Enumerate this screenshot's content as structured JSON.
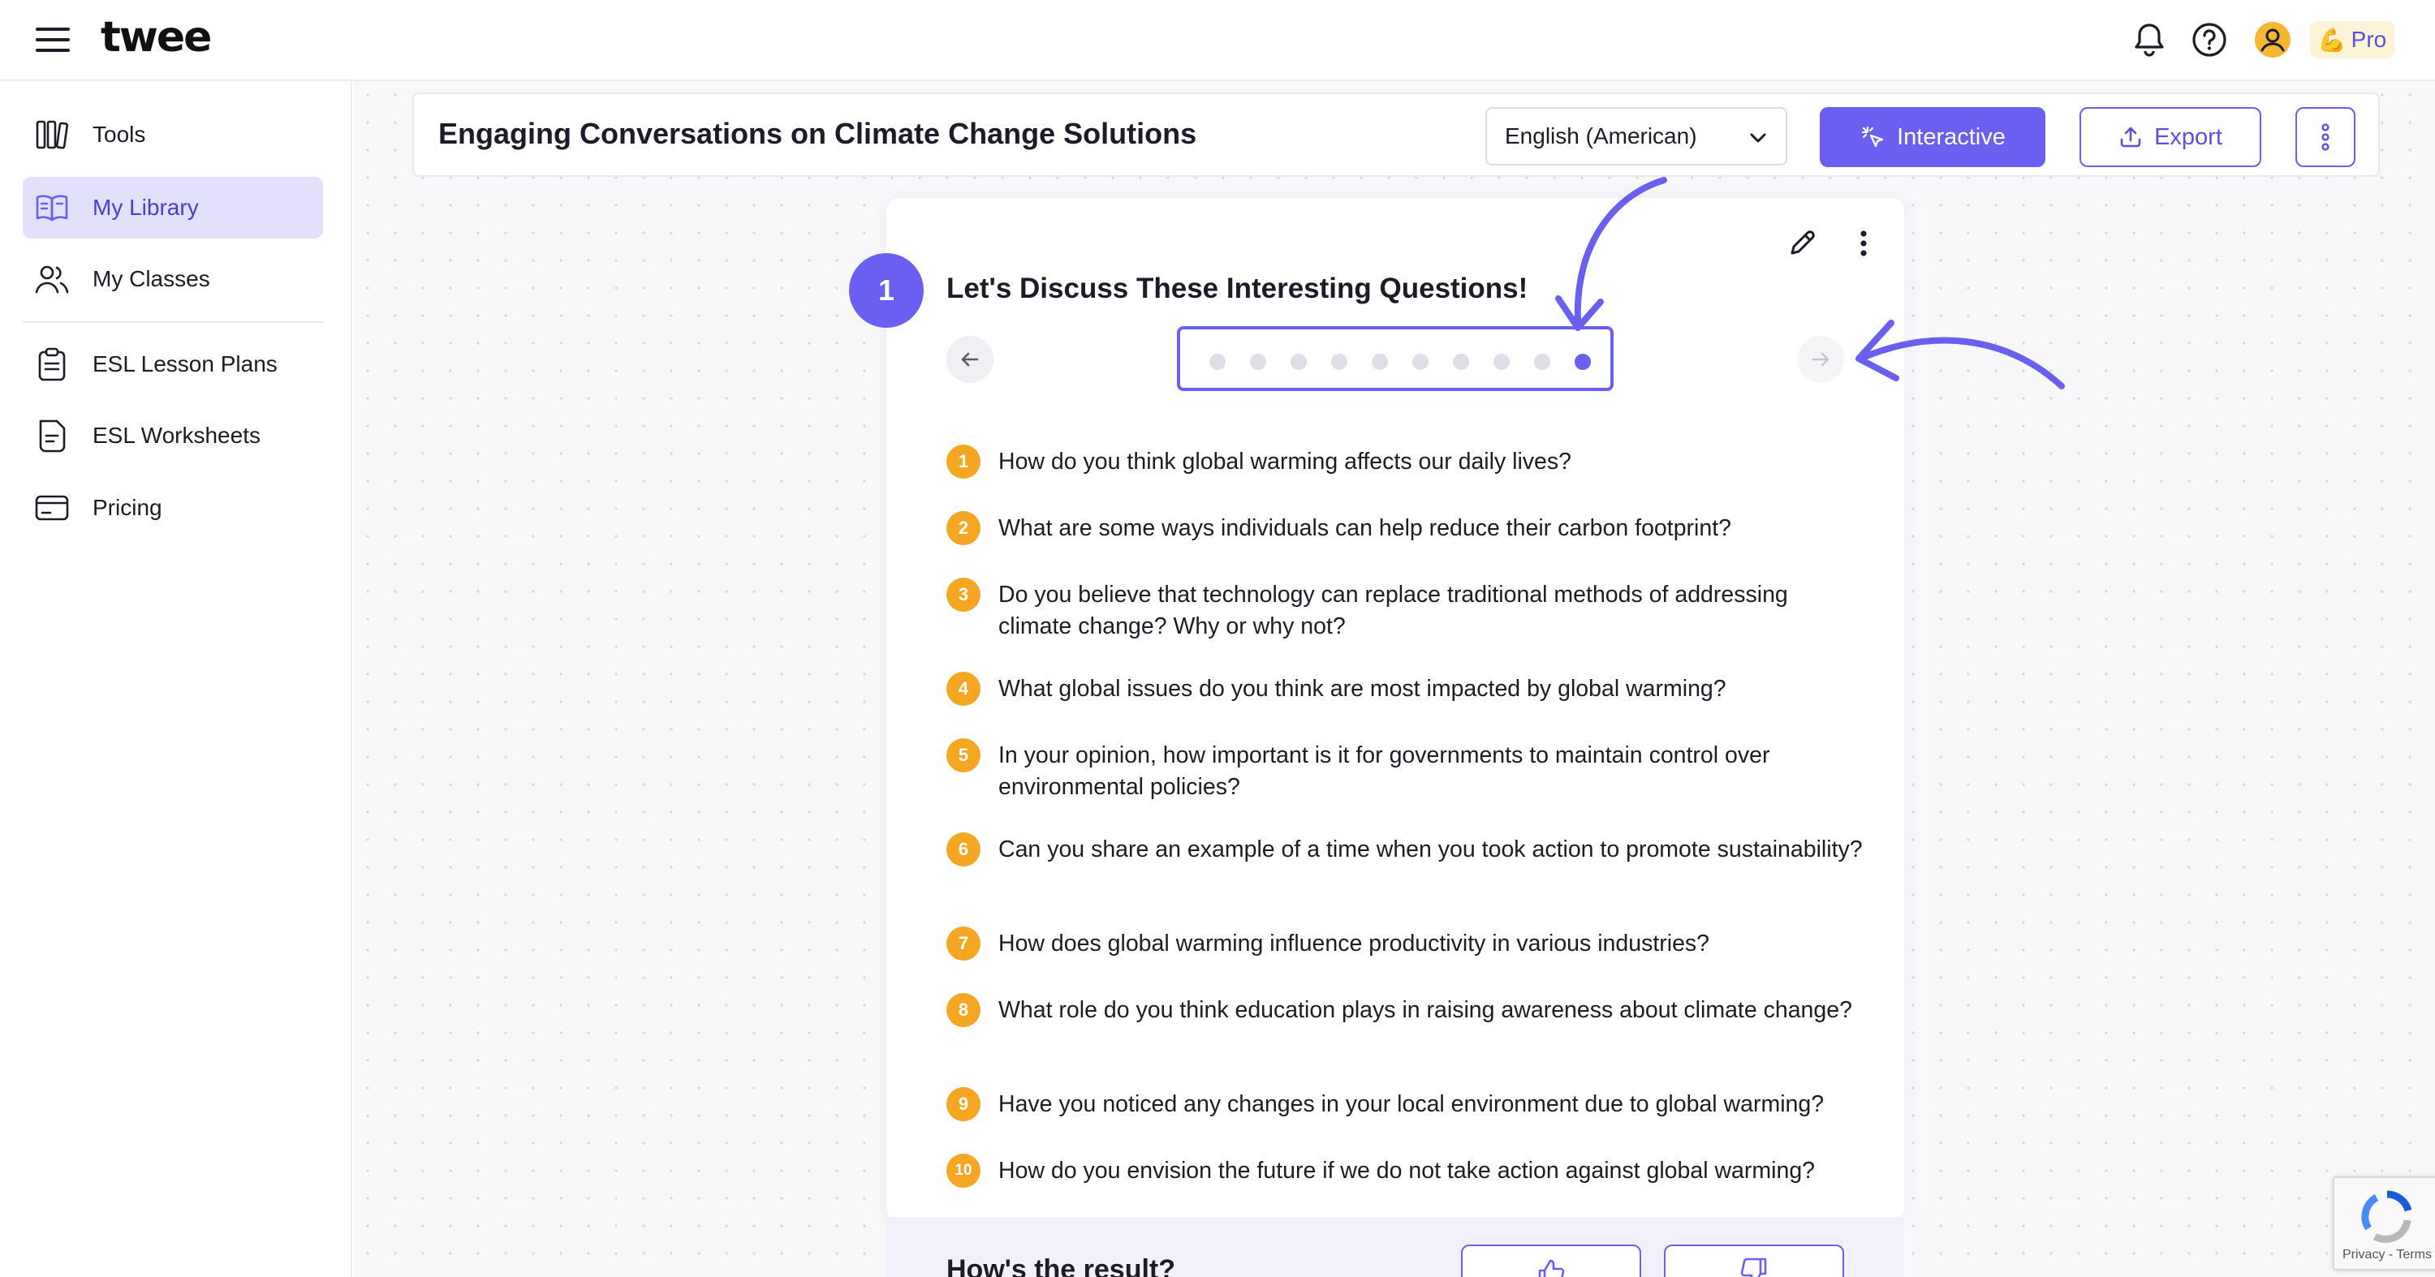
{
  "app": {
    "logo": "twee",
    "pro_label": "Pro",
    "pro_emoji": "💪"
  },
  "sidebar": {
    "items": [
      {
        "label": "Tools",
        "icon": "tools-icon"
      },
      {
        "label": "My Library",
        "icon": "book-icon",
        "active": true
      },
      {
        "label": "My Classes",
        "icon": "users-icon"
      },
      {
        "label": "ESL Lesson Plans",
        "icon": "clipboard-icon"
      },
      {
        "label": "ESL Worksheets",
        "icon": "worksheet-icon"
      },
      {
        "label": "Pricing",
        "icon": "credit-card-icon"
      }
    ]
  },
  "doc": {
    "title": "Engaging Conversations on Climate Change Solutions",
    "language": "English (American)",
    "interactive_label": "Interactive",
    "export_label": "Export"
  },
  "card": {
    "step": "1",
    "title": "Let's Discuss These Interesting Questions!",
    "pager_total": 10,
    "pager_active": 10,
    "questions": [
      {
        "num": "1",
        "text": "How do you think global warming affects our daily lives?"
      },
      {
        "num": "2",
        "text": "What are some ways individuals can help reduce their carbon footprint?"
      },
      {
        "num": "3",
        "text": "Do you believe that technology can replace traditional methods of addressing climate change? Why or why not?"
      },
      {
        "num": "4",
        "text": "What global issues do you think are most impacted by global warming?"
      },
      {
        "num": "5",
        "text": "In your opinion, how important is it for governments to maintain control over environmental policies?"
      },
      {
        "num": "6",
        "text": "Can you share an example of a time when you took action to promote sustainability?"
      },
      {
        "num": "7",
        "text": "How does global warming influence productivity in various industries?"
      },
      {
        "num": "8",
        "text": "What role do you think education plays in raising awareness about climate change?"
      },
      {
        "num": "9",
        "text": "Have you noticed any changes in your local environment due to global warming?"
      },
      {
        "num": "10",
        "text": "How do you envision the future if we do not take action against global warming?"
      }
    ]
  },
  "feedback": {
    "prompt": "How's the result?"
  },
  "recaptcha": {
    "links": "Privacy - Terms"
  },
  "colors": {
    "accent": "#6a5ff0",
    "number_badge": "#f5a623",
    "active_nav_bg": "#e2e0fb"
  }
}
